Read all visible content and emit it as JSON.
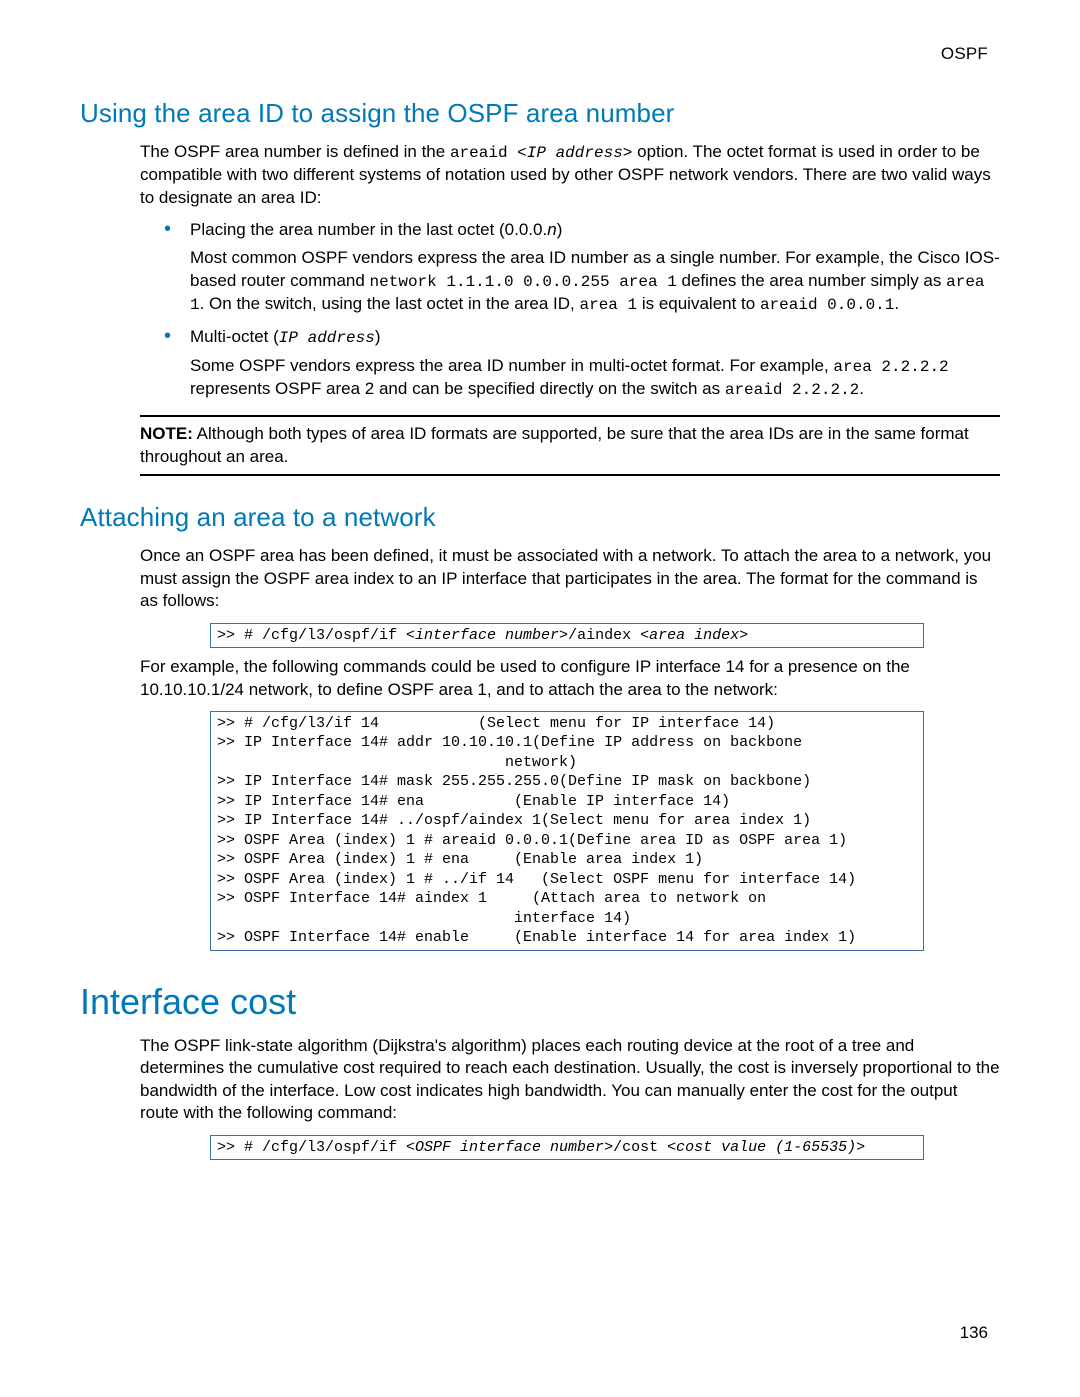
{
  "header": {
    "label": "OSPF"
  },
  "section1": {
    "title": "Using the area ID to assign the OSPF area number",
    "intro_pre": "The OSPF area number is defined in the ",
    "intro_code1": "areaid ",
    "intro_code2": "<IP address>",
    "intro_post": " option. The octet format is used in order to be compatible with two different systems of notation used by other OSPF network vendors. There are two valid ways to designate an area ID:",
    "bullet1": {
      "lead_pre": "Placing the area number in the last octet (0.0.0.",
      "lead_it": "n",
      "lead_post": ")",
      "body_parts": [
        "Most common OSPF vendors express the area ID number as a single number. For example, the Cisco IOS-based router command ",
        "network 1.1.1.0 0.0.0.255 area 1",
        " defines the area number simply as ",
        "area 1",
        ". On the switch, using the last octet in the area ID, ",
        "area 1",
        " is equivalent to ",
        "areaid 0.0.0.1",
        "."
      ]
    },
    "bullet2": {
      "lead_pre": "Multi-octet (",
      "lead_code": "IP address",
      "lead_post": ")",
      "body_parts": [
        "Some OSPF vendors express the area ID number in multi-octet format. For example, ",
        "area 2.2.2.2",
        " represents OSPF area 2 and can be specified directly on the switch as ",
        "areaid 2.2.2.2",
        "."
      ]
    },
    "note_label": "NOTE:",
    "note_body": " Although both types of area ID formats are supported, be sure that the area IDs are in the same format throughout an area."
  },
  "section2": {
    "title": "Attaching an area to a network",
    "para1": "Once an OSPF area has been defined, it must be associated with a network. To attach the area to a network, you must assign the OSPF area index to an IP interface that participates in the area. The format for the command is as follows:",
    "code1_pre": ">> # /cfg/l3/ospf/if ",
    "code1_it1": "<interface number>",
    "code1_mid": "/aindex ",
    "code1_it2": "<area index>",
    "para2": "For example, the following commands could be used to configure IP interface 14 for a presence on the 10.10.10.1/24 network, to define OSPF area 1, and to attach the area to the network:",
    "codeblock": ">> # /cfg/l3/if 14           (Select menu for IP interface 14)\n>> IP Interface 14# addr 10.10.10.1(Define IP address on backbone\n                                network)\n>> IP Interface 14# mask 255.255.255.0(Define IP mask on backbone)\n>> IP Interface 14# ena          (Enable IP interface 14)\n>> IP Interface 14# ../ospf/aindex 1(Select menu for area index 1)\n>> OSPF Area (index) 1 # areaid 0.0.0.1(Define area ID as OSPF area 1)\n>> OSPF Area (index) 1 # ena     (Enable area index 1)\n>> OSPF Area (index) 1 # ../if 14   (Select OSPF menu for interface 14)\n>> OSPF Interface 14# aindex 1     (Attach area to network on\n                                 interface 14)\n>> OSPF Interface 14# enable     (Enable interface 14 for area index 1)"
  },
  "section3": {
    "title": "Interface cost",
    "para1": "The OSPF link-state algorithm (Dijkstra's algorithm) places each routing device at the root of a tree and determines the cumulative cost required to reach each destination. Usually, the cost is inversely proportional to the bandwidth of the interface. Low cost indicates high bandwidth. You can manually enter the cost for the output route with the following command:",
    "code1_pre": ">> # /cfg/l3/ospf/if ",
    "code1_it1": "<OSPF interface number>",
    "code1_mid": "/cost ",
    "code1_it2": "<cost value (1-65535)>"
  },
  "page_number": "136"
}
